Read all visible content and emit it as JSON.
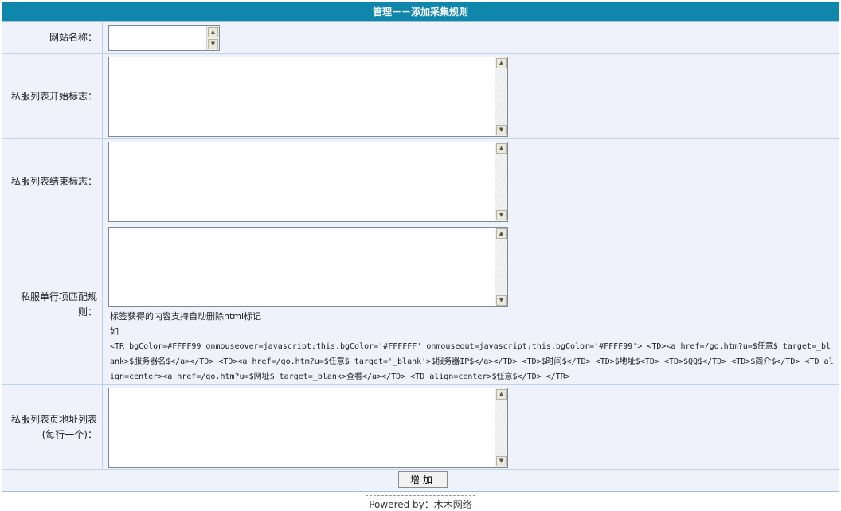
{
  "header": {
    "title": "管理－－添加采集规则"
  },
  "fields": [
    {
      "label": "网站名称："
    },
    {
      "label": "私服列表开始标志："
    },
    {
      "label": "私服列表结束标志："
    },
    {
      "label": "私服单行项匹配规则："
    },
    {
      "label": "私服列表页地址列表(每行一个)："
    }
  ],
  "hint": {
    "line1": "标签获得的内容支持自动删除html标记",
    "line2": "如",
    "code": "<TR bgColor=#FFFF99 onmouseover=javascript:this.bgColor='#FFFFFF' onmouseout=javascript:this.bgColor='#FFFF99'> <TD><a href=/go.htm?u=$任意$ target=_blank>$服务器名$</a></TD> <TD><a href=/go.htm?u=$任意$ target='_blank'>$服务器IP$</a></TD> <TD>$时间$</TD> <TD>$地址$<TD> <TD>$QQ$</TD> <TD>$简介$</TD> <TD align=center><a href=/go.htm?u=$网址$ target=_blank>查看</a></TD> <TD align=center>$任意$</TD> </TR>"
  },
  "submit": {
    "label": "增加"
  },
  "footer": {
    "text": "Powered by：木木网络"
  },
  "colors": {
    "header_bg": "#0f87ad",
    "panel_bg": "#eff2fb",
    "border": "#bcd4ea"
  }
}
